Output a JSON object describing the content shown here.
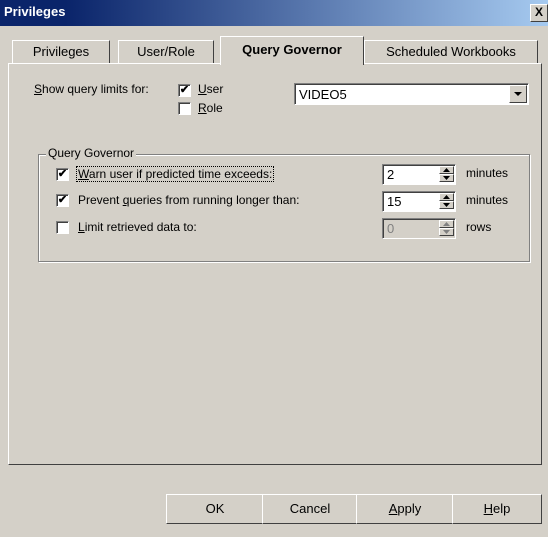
{
  "window": {
    "title": "Privileges",
    "close_glyph": "X"
  },
  "tabs": [
    {
      "label": "Privileges"
    },
    {
      "label": "User/Role"
    },
    {
      "label": "Query Governor",
      "selected": true
    },
    {
      "label": "Scheduled Workbooks"
    }
  ],
  "show_for": {
    "label": "Show query limits for:",
    "user_label": "User",
    "user_checked": true,
    "role_label": "Role",
    "role_checked": false,
    "selected_value": "VIDEO5"
  },
  "group": {
    "title": "Query Governor",
    "rows": [
      {
        "label": "Warn user if predicted time exceeds:",
        "checked": true,
        "value": "2",
        "unit": "minutes",
        "enabled": true
      },
      {
        "label": "Prevent queries from running longer than:",
        "checked": true,
        "value": "15",
        "unit": "minutes",
        "enabled": true
      },
      {
        "label": "Limit retrieved data to:",
        "checked": false,
        "value": "0",
        "unit": "rows",
        "enabled": false
      }
    ]
  },
  "buttons": {
    "ok": "OK",
    "cancel": "Cancel",
    "apply": "Apply",
    "help": "Help"
  },
  "check_glyph": "✔"
}
